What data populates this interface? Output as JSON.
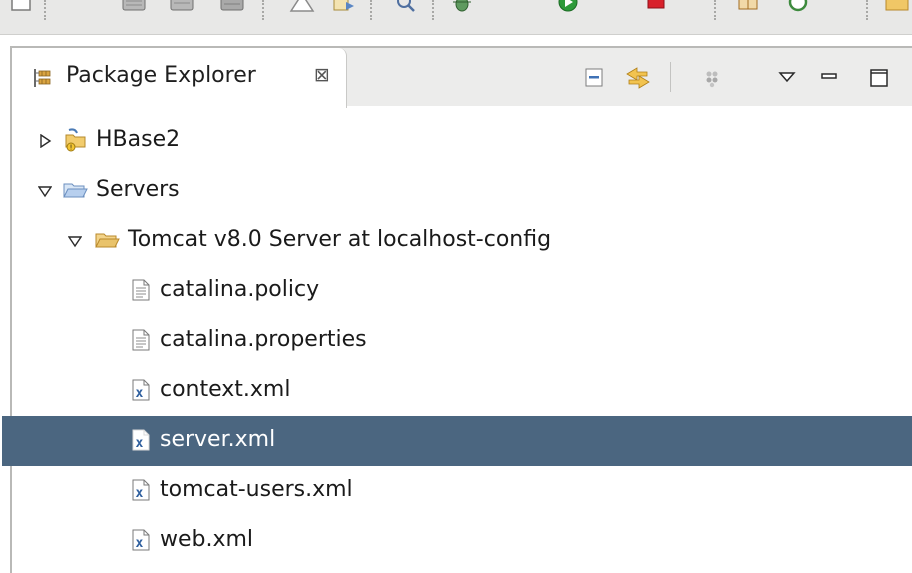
{
  "view": {
    "tab_label": "Package Explorer",
    "tab_close_glyph": "⊠"
  },
  "tree": [
    {
      "label": "HBase2",
      "icon": "java-project-icon",
      "expanded": false
    },
    {
      "label": "Servers",
      "icon": "open-folder-icon",
      "expanded": true
    },
    {
      "label": "Tomcat v8.0 Server at localhost-config",
      "icon": "open-folder-icon",
      "expanded": true
    },
    {
      "label": "catalina.policy",
      "icon": "text-file-icon"
    },
    {
      "label": "catalina.properties",
      "icon": "text-file-icon"
    },
    {
      "label": "context.xml",
      "icon": "xml-file-icon"
    },
    {
      "label": "server.xml",
      "icon": "xml-file-icon",
      "selected": true
    },
    {
      "label": "tomcat-users.xml",
      "icon": "xml-file-icon"
    },
    {
      "label": "web.xml",
      "icon": "xml-file-icon"
    }
  ],
  "colors": {
    "selection": "#4b6680",
    "folder": "#e9c36b",
    "folder_outline": "#b9892b"
  }
}
